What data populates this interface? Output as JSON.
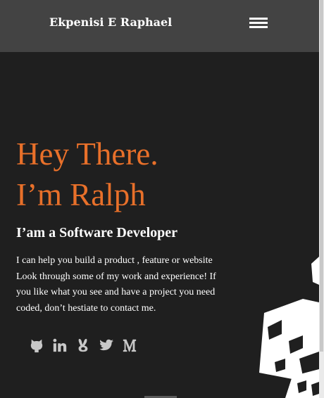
{
  "navbar": {
    "brand": "Ekpenisi E Raphael",
    "menu_icon": "hamburger-menu-icon"
  },
  "hero": {
    "heading_line1": "Hey There.",
    "heading_line2": "I’m Ralph",
    "subheading": "I’am a Software Developer",
    "description_lines": [
      "I can help you build a product , feature or website",
      "Look through some of my work and experience! If",
      "you like what you see and have a project you need",
      "coded, don’t hestiate to contact me."
    ]
  },
  "socials": [
    {
      "icon": "github-icon"
    },
    {
      "icon": "linkedin-icon"
    },
    {
      "icon": "hackerrank-icon"
    },
    {
      "icon": "twitter-icon"
    },
    {
      "icon": "medium-icon"
    }
  ],
  "colors": {
    "background": "#1f1f1f",
    "navbar": "#434343",
    "accent": "#e8702a",
    "text": "#ffffff",
    "icon": "#c8c8c8"
  }
}
